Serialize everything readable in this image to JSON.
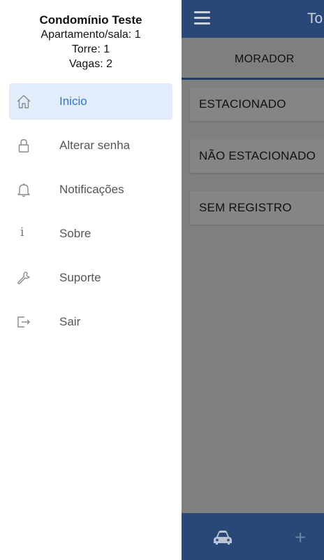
{
  "app": {
    "top_title": "To",
    "tab_label": "MORADOR",
    "status_items": [
      "ESTACIONADO",
      "NÃO ESTACIONADO",
      "SEM REGISTRO"
    ]
  },
  "drawer": {
    "condo_name": "Condomínio Teste",
    "apartment": "Apartamento/sala: 1",
    "tower": "Torre: 1",
    "spots": "Vagas: 2",
    "menu": [
      {
        "label": "Inicio",
        "icon": "home-icon",
        "active": true
      },
      {
        "label": "Alterar senha",
        "icon": "lock-icon",
        "active": false
      },
      {
        "label": "Notificações",
        "icon": "bell-icon",
        "active": false
      },
      {
        "label": "Sobre",
        "icon": "info-icon",
        "active": false
      },
      {
        "label": "Suporte",
        "icon": "wrench-icon",
        "active": false
      },
      {
        "label": "Sair",
        "icon": "logout-icon",
        "active": false
      }
    ]
  },
  "colors": {
    "primary": "#2a4877",
    "active_text": "#2f76d9",
    "active_bg": "#e2edfb"
  }
}
